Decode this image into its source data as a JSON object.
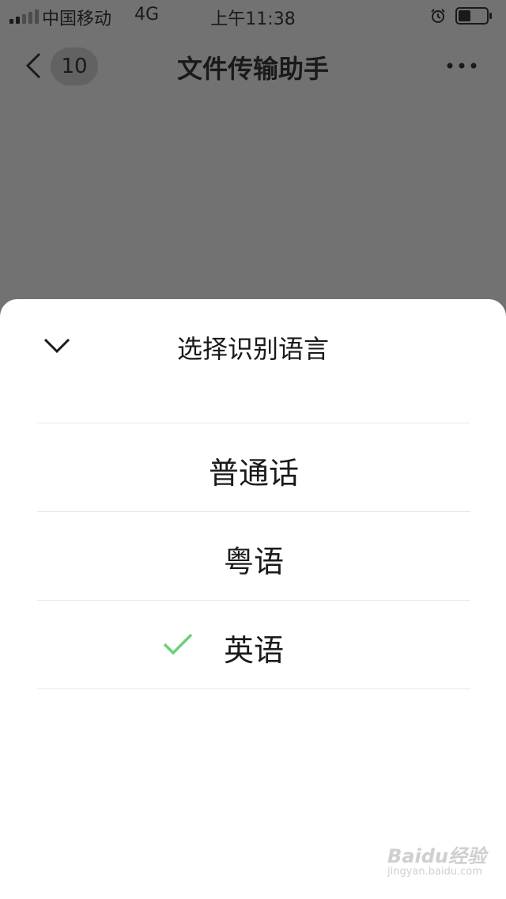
{
  "status_bar": {
    "carrier": "中国移动",
    "network": "4G",
    "time": "上午11:38",
    "battery_level": 0.45
  },
  "nav": {
    "back_badge": "10",
    "title": "文件传输助手"
  },
  "sheet": {
    "title": "选择识别语言",
    "options": [
      {
        "label": "普通话",
        "selected": false
      },
      {
        "label": "粤语",
        "selected": false
      },
      {
        "label": "英语",
        "selected": true
      }
    ]
  },
  "colors": {
    "check": "#6bcf7a",
    "dim": "#727272"
  },
  "watermark": {
    "logo": "Baidu经验",
    "sub": "jingyan.baidu.com"
  }
}
